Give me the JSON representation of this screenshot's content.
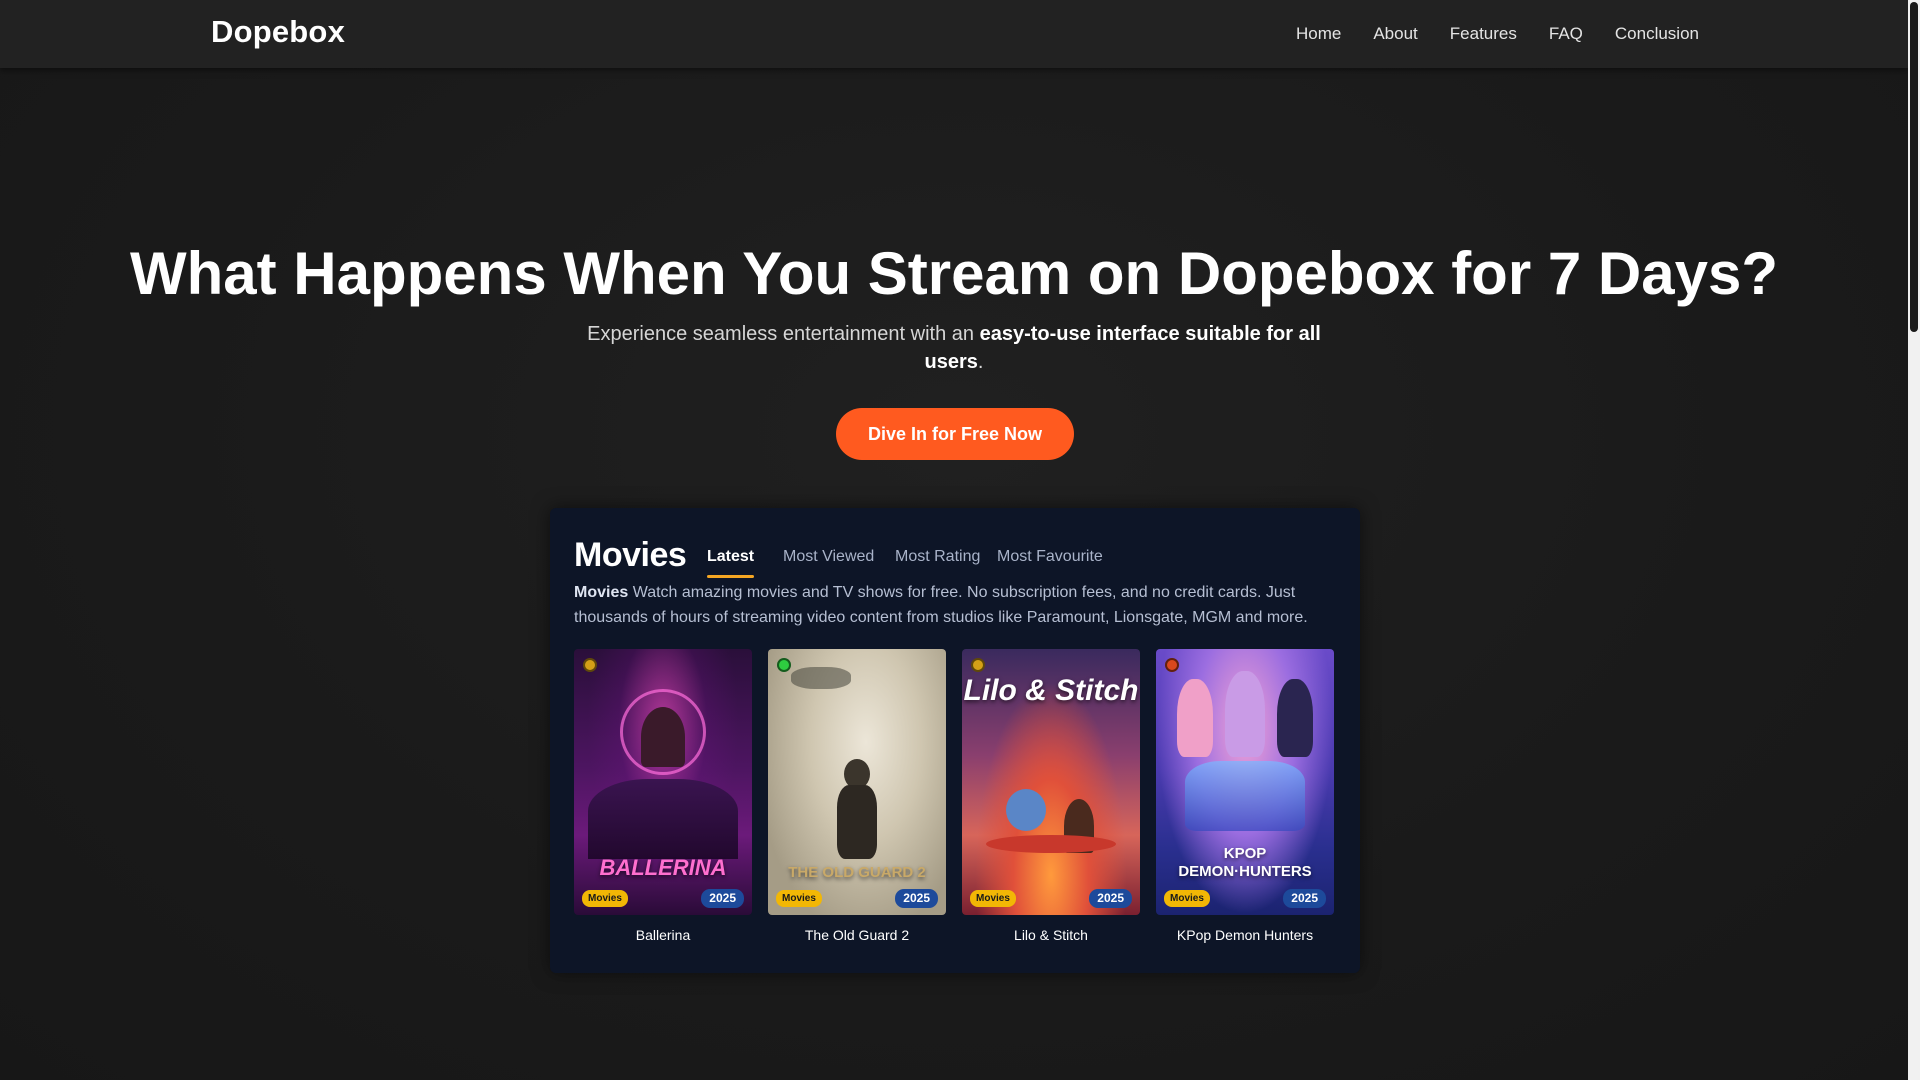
{
  "navbar": {
    "brand": "Dopebox",
    "links": [
      "Home",
      "About",
      "Features",
      "FAQ",
      "Conclusion"
    ]
  },
  "hero": {
    "title": "What Happens When You Stream on Dopebox for 7 Days?",
    "subtitle_plain": "Experience seamless entertainment with an ",
    "subtitle_bold": "easy-to-use interface suitable for all users",
    "subtitle_end": ".",
    "cta_label": "Dive In for Free Now"
  },
  "movies_panel": {
    "title": "Movies",
    "tabs": [
      "Latest",
      "Most Viewed",
      "Most Rating",
      "Most Favourite"
    ],
    "active_tab": "Latest",
    "desc_bold": "Movies",
    "desc_text": " Watch amazing movies and TV shows for free. No subscription fees, and no credit cards. Just thousands of hours of streaming video content from studios like Paramount, Lionsgate, MGM and more.",
    "cards": [
      {
        "title": "Ballerina",
        "category": "Movies",
        "year": "2025",
        "dot_color": "#d4a017",
        "poster_text": "BALLERINA"
      },
      {
        "title": "The Old Guard 2",
        "category": "Movies",
        "year": "2025",
        "dot_color": "#2ecc40",
        "poster_text": "THE OLD GUARD 2"
      },
      {
        "title": "Lilo & Stitch",
        "category": "Movies",
        "year": "2025",
        "dot_color": "#d4a017",
        "poster_text": "Lilo & Stitch"
      },
      {
        "title": "KPop Demon Hunters",
        "category": "Movies",
        "year": "2025",
        "dot_color": "#d9481e",
        "poster_text": "KPOP DEMON·HUNTERS"
      }
    ]
  },
  "colors": {
    "accent": "#ff5a1f",
    "tab_underline": "#f5a623",
    "panel_bg": "#0d1527",
    "category_badge": "#f2b705",
    "year_badge": "#1d4a9b"
  }
}
